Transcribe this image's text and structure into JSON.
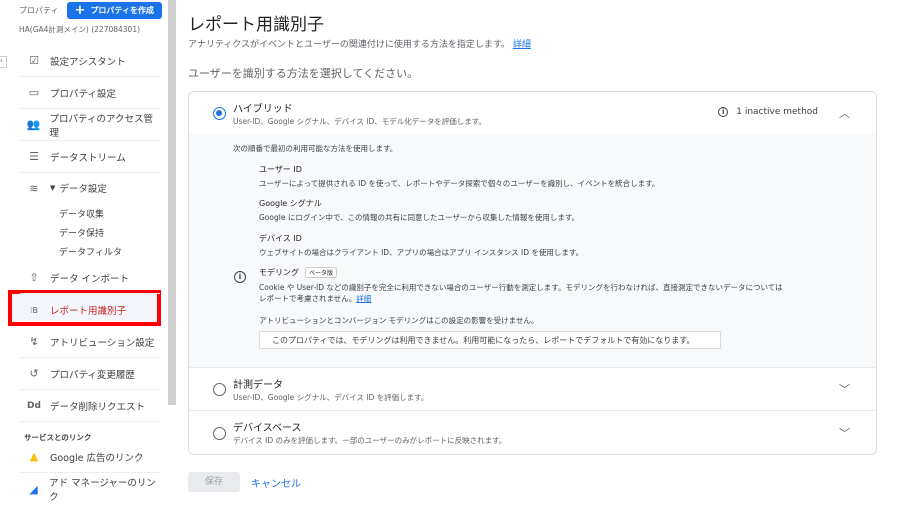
{
  "sidebar": {
    "property_label": "プロパティ",
    "create_button": "プロパティを作成",
    "property_id": "HA(GA4計測メイン) (227084301)",
    "items": [
      {
        "label": "設定アシスタント",
        "icon": "checklist-icon"
      },
      {
        "label": "プロパティ設定",
        "icon": "layout-icon"
      },
      {
        "label": "プロパティのアクセス管理",
        "icon": "people-icon"
      },
      {
        "label": "データストリーム",
        "icon": "streams-icon"
      },
      {
        "label": "データ設定",
        "icon": "database-icon"
      },
      {
        "label": "データ インポート",
        "icon": "upload-icon"
      },
      {
        "label": "レポート用識別子",
        "icon": "identifier-icon"
      },
      {
        "label": "アトリビューション設定",
        "icon": "attribution-icon"
      },
      {
        "label": "プロパティ変更履歴",
        "icon": "history-icon"
      },
      {
        "label": "データ削除リクエスト",
        "icon": "dd-icon"
      }
    ],
    "sub_items": [
      "データ収集",
      "データ保持",
      "データフィルタ"
    ],
    "section_title": "サービスとのリンク",
    "links": [
      {
        "label": "Google 広告のリンク"
      },
      {
        "label": "アド マネージャーのリンク"
      }
    ]
  },
  "main": {
    "title": "レポート用識別子",
    "description": "アナリティクスがイベントとユーザーの関連付けに使用する方法を指定します。",
    "details_link": "詳細",
    "prompt": "ユーザーを識別する方法を選択してください。",
    "options": [
      {
        "title": "ハイブリッド",
        "subtitle": "User-ID、Google シグナル、デバイス ID、モデル化データを評価します。",
        "selected": true,
        "status": "1 inactive method"
      },
      {
        "title": "計測データ",
        "subtitle": "User-ID、Google シグナル、デバイス ID を評価します。",
        "selected": false
      },
      {
        "title": "デバイスベース",
        "subtitle": "デバイス ID のみを評価します。一部のユーザーのみがレポートに反映されます。",
        "selected": false
      }
    ],
    "hybrid_detail": {
      "intro": "次の順番で最初の利用可能な方法を使用します。",
      "methods": [
        {
          "title": "ユーザー ID",
          "desc": "ユーザーによって提供される ID を使って、レポートやデータ探索で個々のユーザーを識別し、イベントを統合します。"
        },
        {
          "title": "Google シグナル",
          "desc": "Google にログイン中で、この情報の共有に同意したユーザーから収集した情報を使用します。"
        },
        {
          "title": "デバイス ID",
          "desc": "ウェブサイトの場合はクライアント ID、アプリの場合はアプリ インスタンス ID を使用します。"
        }
      ],
      "modeling_title": "モデリング",
      "beta_badge": "ベータ版",
      "modeling_desc1": "Cookie や User-ID などの識別子を完全に利用できない場合のユーザー行動を測定します。モデリングを行わなければ、直接測定できないデータについては",
      "modeling_desc2": "レポートで考慮されません。",
      "modeling_link": "詳細",
      "attribution_note": "アトリビューションとコンバージョン モデリングはこの設定の影響を受けません。",
      "notice": "このプロパティでは、モデリングは利用できません。利用可能になったら、レポートでデフォルトで有効になります。"
    },
    "save_button": "保存",
    "cancel_button": "キャンセル"
  },
  "colors": {
    "accent": "#1a73e8",
    "highlight": "#ff0000"
  }
}
